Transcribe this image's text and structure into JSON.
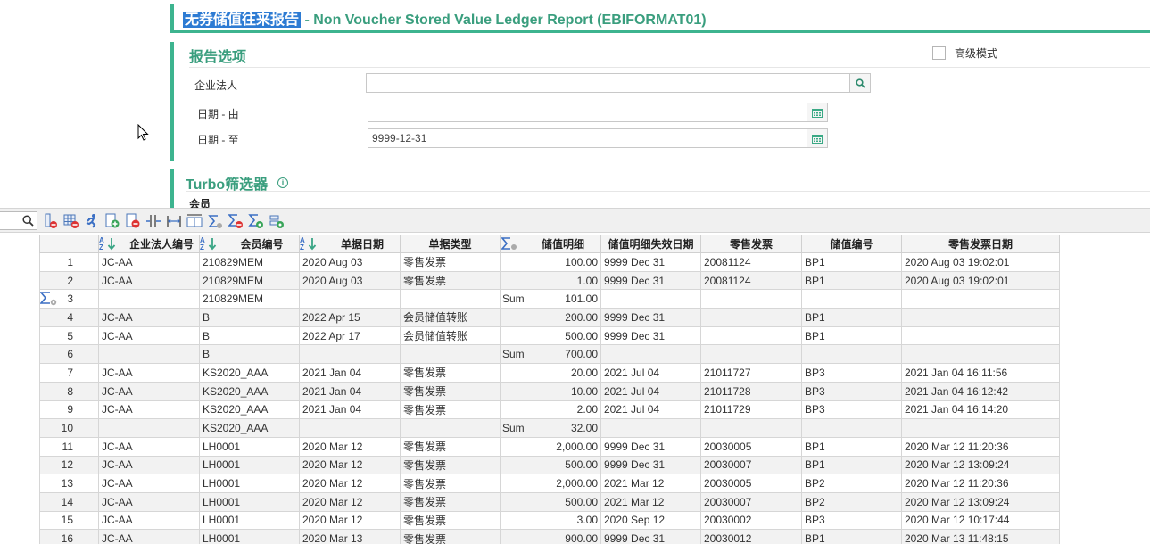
{
  "header": {
    "title_cn": "无券储值往来报告",
    "title_en": " - Non Voucher Stored Value Ledger Report (EBIFORMAT01)"
  },
  "options": {
    "section_title": "报告选项",
    "advanced_label": "高级模式",
    "fields": [
      {
        "label": "企业法人",
        "value": "",
        "button": "search-icon"
      },
      {
        "label": "日期 - 由",
        "value": "",
        "button": "calendar-icon"
      },
      {
        "label": "日期 - 至",
        "value": "9999-12-31",
        "button": "calendar-icon"
      }
    ]
  },
  "turbo": {
    "title": "Turbo筛选器",
    "member_label": "会员"
  },
  "toolbar": {
    "icons": [
      "remove-column-icon",
      "remove-grid-icon",
      "run-icon",
      "add-page-icon",
      "remove-page-icon",
      "split-columns-icon",
      "fit-width-icon",
      "fit-all-icon",
      "sum-icon",
      "remove-sum-icon",
      "sum-settings-icon",
      "filter-settings-icon"
    ]
  },
  "grid": {
    "columns": [
      "",
      "企业法人编号",
      "会员编号",
      "单据日期",
      "单据类型",
      "储值明细",
      "储值明细失效日期",
      "零售发票",
      "储值编号",
      "零售发票日期"
    ],
    "rows": [
      {
        "n": "1",
        "entity": "JC-AA",
        "member": "210829MEM",
        "date": "2020 Aug 03",
        "type": "零售发票",
        "sumlabel": "",
        "amount": "100.00",
        "expiry": "9999 Dec 31",
        "invoice": "20081124",
        "sv": "BP1",
        "invdate": "2020 Aug 03 19:02:01",
        "sum": false
      },
      {
        "n": "2",
        "entity": "JC-AA",
        "member": "210829MEM",
        "date": "2020 Aug 03",
        "type": "零售发票",
        "sumlabel": "",
        "amount": "1.00",
        "expiry": "9999 Dec 31",
        "invoice": "20081124",
        "sv": "BP1",
        "invdate": "2020 Aug 03 19:02:01",
        "sum": false
      },
      {
        "n": "3",
        "entity": "",
        "member": "210829MEM",
        "date": "",
        "type": "",
        "sumlabel": "Sum",
        "amount": "101.00",
        "expiry": "",
        "invoice": "",
        "sv": "",
        "invdate": "",
        "sum": true
      },
      {
        "n": "4",
        "entity": "JC-AA",
        "member": "B",
        "date": "2022 Apr 15",
        "type": "会员储值转账",
        "sumlabel": "",
        "amount": "200.00",
        "expiry": "9999 Dec 31",
        "invoice": "",
        "sv": "BP1",
        "invdate": "",
        "sum": false
      },
      {
        "n": "5",
        "entity": "JC-AA",
        "member": "B",
        "date": "2022 Apr 17",
        "type": "会员储值转账",
        "sumlabel": "",
        "amount": "500.00",
        "expiry": "9999 Dec 31",
        "invoice": "",
        "sv": "BP1",
        "invdate": "",
        "sum": false
      },
      {
        "n": "6",
        "entity": "",
        "member": "B",
        "date": "",
        "type": "",
        "sumlabel": "Sum",
        "amount": "700.00",
        "expiry": "",
        "invoice": "",
        "sv": "",
        "invdate": "",
        "sum": true
      },
      {
        "n": "7",
        "entity": "JC-AA",
        "member": "KS2020_AAA",
        "date": "2021 Jan 04",
        "type": "零售发票",
        "sumlabel": "",
        "amount": "20.00",
        "expiry": "2021 Jul 04",
        "invoice": "21011727",
        "sv": "BP3",
        "invdate": "2021 Jan 04 16:11:56",
        "sum": false
      },
      {
        "n": "8",
        "entity": "JC-AA",
        "member": "KS2020_AAA",
        "date": "2021 Jan 04",
        "type": "零售发票",
        "sumlabel": "",
        "amount": "10.00",
        "expiry": "2021 Jul 04",
        "invoice": "21011728",
        "sv": "BP3",
        "invdate": "2021 Jan 04 16:12:42",
        "sum": false
      },
      {
        "n": "9",
        "entity": "JC-AA",
        "member": "KS2020_AAA",
        "date": "2021 Jan 04",
        "type": "零售发票",
        "sumlabel": "",
        "amount": "2.00",
        "expiry": "2021 Jul 04",
        "invoice": "21011729",
        "sv": "BP3",
        "invdate": "2021 Jan 04 16:14:20",
        "sum": false
      },
      {
        "n": "10",
        "entity": "",
        "member": "KS2020_AAA",
        "date": "",
        "type": "",
        "sumlabel": "Sum",
        "amount": "32.00",
        "expiry": "",
        "invoice": "",
        "sv": "",
        "invdate": "",
        "sum": true
      },
      {
        "n": "11",
        "entity": "JC-AA",
        "member": "LH0001",
        "date": "2020 Mar 12",
        "type": "零售发票",
        "sumlabel": "",
        "amount": "2,000.00",
        "expiry": "9999 Dec 31",
        "invoice": "20030005",
        "sv": "BP1",
        "invdate": "2020 Mar 12 11:20:36",
        "sum": false
      },
      {
        "n": "12",
        "entity": "JC-AA",
        "member": "LH0001",
        "date": "2020 Mar 12",
        "type": "零售发票",
        "sumlabel": "",
        "amount": "500.00",
        "expiry": "9999 Dec 31",
        "invoice": "20030007",
        "sv": "BP1",
        "invdate": "2020 Mar 12 13:09:24",
        "sum": false
      },
      {
        "n": "13",
        "entity": "JC-AA",
        "member": "LH0001",
        "date": "2020 Mar 12",
        "type": "零售发票",
        "sumlabel": "",
        "amount": "2,000.00",
        "expiry": "2021 Mar 12",
        "invoice": "20030005",
        "sv": "BP2",
        "invdate": "2020 Mar 12 11:20:36",
        "sum": false
      },
      {
        "n": "14",
        "entity": "JC-AA",
        "member": "LH0001",
        "date": "2020 Mar 12",
        "type": "零售发票",
        "sumlabel": "",
        "amount": "500.00",
        "expiry": "2021 Mar 12",
        "invoice": "20030007",
        "sv": "BP2",
        "invdate": "2020 Mar 12 13:09:24",
        "sum": false
      },
      {
        "n": "15",
        "entity": "JC-AA",
        "member": "LH0001",
        "date": "2020 Mar 12",
        "type": "零售发票",
        "sumlabel": "",
        "amount": "3.00",
        "expiry": "2020 Sep 12",
        "invoice": "20030002",
        "sv": "BP3",
        "invdate": "2020 Mar 12 10:17:44",
        "sum": false
      },
      {
        "n": "16",
        "entity": "JC-AA",
        "member": "LH0001",
        "date": "2020 Mar 13",
        "type": "零售发票",
        "sumlabel": "",
        "amount": "900.00",
        "expiry": "9999 Dec 31",
        "invoice": "20030012",
        "sv": "BP1",
        "invdate": "2020 Mar 13 11:48:15",
        "sum": false
      }
    ]
  },
  "colors": {
    "accent": "#3db48f",
    "link": "#3fae8a",
    "highlight": "#2d7bd3"
  }
}
